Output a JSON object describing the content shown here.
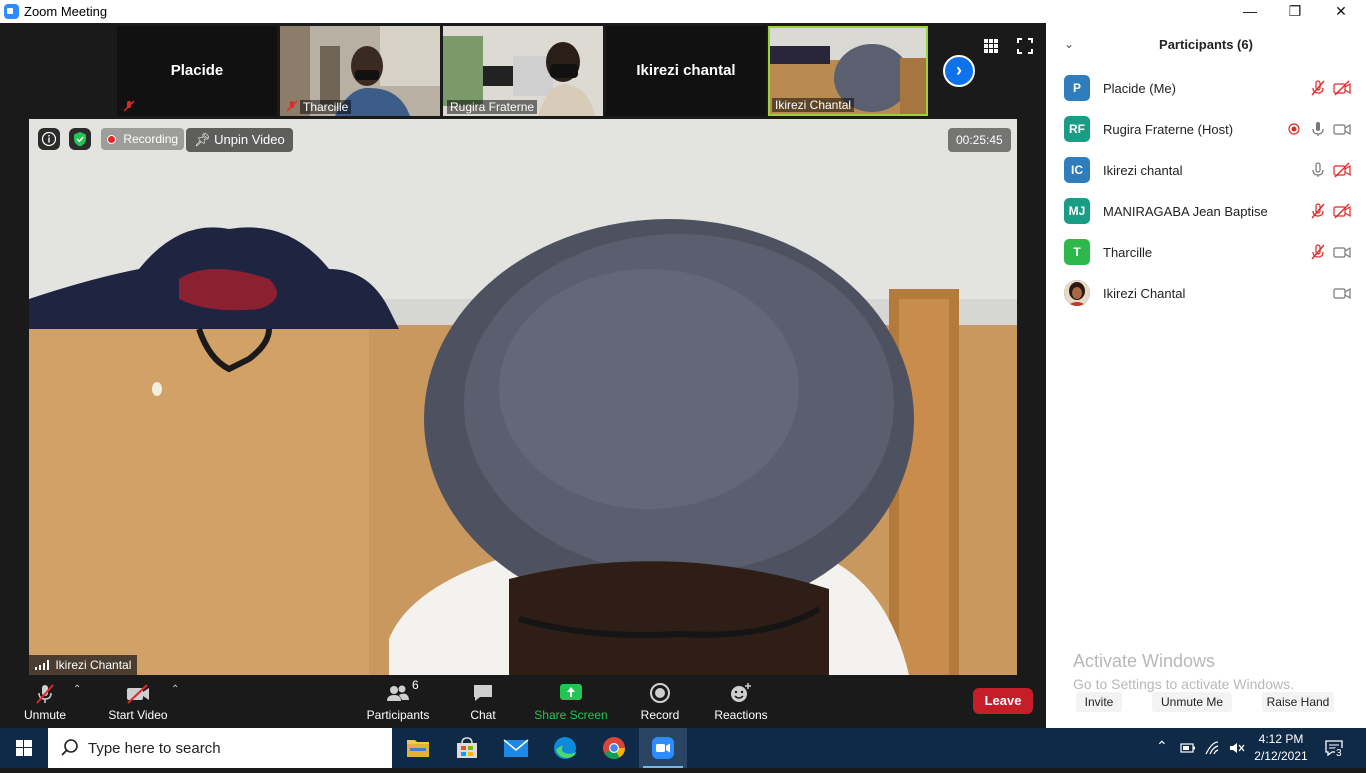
{
  "window": {
    "title": "Zoom Meeting",
    "controls": {
      "minimize": "—",
      "restore": "❐",
      "close": "✕"
    }
  },
  "strip": {
    "tiles": [
      {
        "name": "Placide",
        "label": "",
        "type": "name-only",
        "muted": true
      },
      {
        "name": "",
        "label": "Tharcille",
        "type": "video",
        "muted": true
      },
      {
        "name": "",
        "label": "Rugira Fraterne",
        "type": "video",
        "muted": false
      },
      {
        "name": "Ikirezi chantal",
        "label": "",
        "type": "name-only",
        "muted": false
      },
      {
        "name": "",
        "label": "Ikirezi Chantal",
        "type": "video",
        "muted": false,
        "active": true
      }
    ],
    "next_icon": "chevron-right-icon"
  },
  "main_video": {
    "recording_label": "Recording",
    "unpin_label": "Unpin Video",
    "timer": "00:25:45",
    "speaker_name": "Ikirezi Chantal"
  },
  "toolbar": {
    "unmute_label": "Unmute",
    "start_video_label": "Start Video",
    "participants_label": "Participants",
    "participants_count": "6",
    "chat_label": "Chat",
    "share_label": "Share Screen",
    "record_label": "Record",
    "reactions_label": "Reactions",
    "leave_label": "Leave"
  },
  "panel": {
    "title": "Participants (6)",
    "participants": [
      {
        "initials": "P",
        "name": "Placide (Me)",
        "color": "#2f7dbd",
        "mic": "muted",
        "video": "off",
        "recording": false
      },
      {
        "initials": "RF",
        "name": "Rugira Fraterne (Host)",
        "color": "#1b9d85",
        "mic": "on",
        "video": "on",
        "recording": true
      },
      {
        "initials": "IC",
        "name": "Ikirezi chantal",
        "color": "#2f7dbd",
        "mic": "on",
        "video": "off",
        "recording": false
      },
      {
        "initials": "MJ",
        "name": "MANIRAGABA Jean Baptise",
        "color": "#1b9d85",
        "mic": "muted",
        "video": "off",
        "recording": false
      },
      {
        "initials": "T",
        "name": "Tharcille",
        "color": "#2eb84b",
        "mic": "muted",
        "video": "on",
        "recording": false
      },
      {
        "initials": "",
        "name": "Ikirezi Chantal",
        "color": "#6b3b2a",
        "mic": "none",
        "video": "on",
        "recording": false
      }
    ],
    "activate_title": "Activate Windows",
    "activate_sub": "Go to Settings to activate Windows.",
    "invite_label": "Invite",
    "unmute_me_label": "Unmute Me",
    "raise_hand_label": "Raise Hand"
  },
  "taskbar": {
    "search_placeholder": "Type here to search",
    "time": "4:12 PM",
    "date": "2/12/2021",
    "notification_count": "3"
  },
  "colors": {
    "accent": "#0e72ed",
    "leave": "#c61e28",
    "share": "#23c552",
    "muted_red": "#e02828"
  }
}
